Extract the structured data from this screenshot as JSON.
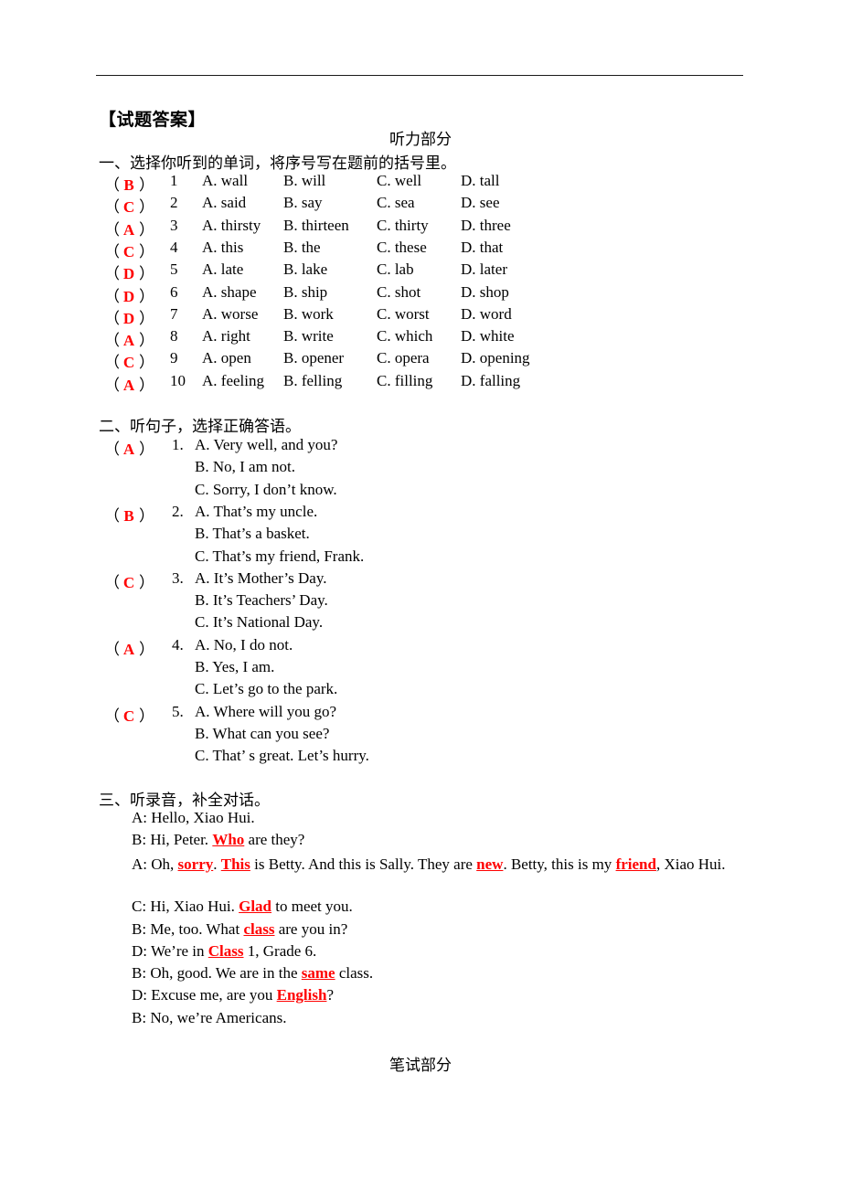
{
  "document": {
    "answer_key_heading": "【试题答案】",
    "listening_section_title": "听力部分",
    "written_section_title": "笔试部分"
  },
  "section_one": {
    "heading": "一、选择你听到的单词，将序号写在题前的括号里。",
    "paren_left": "（",
    "paren_right": "）",
    "rows": [
      {
        "answer": "B",
        "num": "1",
        "a": "A. wall",
        "b": "B. will",
        "c": "C. well",
        "d": "D. tall"
      },
      {
        "answer": "C",
        "num": "2",
        "a": "A. said",
        "b": "B. say",
        "c": "C. sea",
        "d": "D. see"
      },
      {
        "answer": "A",
        "num": "3",
        "a": "A. thirsty",
        "b": "B. thirteen",
        "c": "C. thirty",
        "d": "D. three"
      },
      {
        "answer": "C",
        "num": "4",
        "a": "A. this",
        "b": "B. the",
        "c": "C. these",
        "d": "D. that"
      },
      {
        "answer": "D",
        "num": "5",
        "a": "A. late",
        "b": "B. lake",
        "c": "C. lab",
        "d": "D. later"
      },
      {
        "answer": "D",
        "num": "6",
        "a": "A. shape",
        "b": "B. ship",
        "c": "C. shot",
        "d": "D. shop"
      },
      {
        "answer": "D",
        "num": "7",
        "a": "A. worse",
        "b": "B. work",
        "c": "C. worst",
        "d": "D. word"
      },
      {
        "answer": "A",
        "num": "8",
        "a": "A. right",
        "b": "B. write",
        "c": "C. which",
        "d": "D. white"
      },
      {
        "answer": "C",
        "num": "9",
        "a": "A. open",
        "b": "B. opener",
        "c": "C. opera",
        "d": "D. opening"
      },
      {
        "answer": "A",
        "num": "10",
        "a": "A. feeling",
        "b": "B. felling",
        "c": "C. filling",
        "d": "D. falling"
      }
    ]
  },
  "section_two": {
    "heading": "二、听句子，选择正确答语。",
    "paren_left": "（",
    "paren_right": "）",
    "items": [
      {
        "answer": "A",
        "num": "1.",
        "a": "A. Very well, and you?",
        "b": "B. No, I am not.",
        "c": "C. Sorry, I don’t know."
      },
      {
        "answer": "B",
        "num": "2.",
        "a": "A. That’s my uncle.",
        "b": "B. That’s a basket.",
        "c": "C. That’s my friend, Frank."
      },
      {
        "answer": "C",
        "num": "3.",
        "a": "A. It’s Mother’s Day.",
        "b": "B. It’s Teachers’ Day.",
        "c": "C. It’s National Day."
      },
      {
        "answer": "A",
        "num": "4.",
        "a": "A. No, I do not.",
        "b": "B. Yes, I am.",
        "c": "C. Let’s go to the park."
      },
      {
        "answer": "C",
        "num": "5.",
        "a": "A. Where will you go?",
        "b": "B. What can you see?",
        "c": "C. That’ s great. Let’s hurry."
      }
    ]
  },
  "section_three": {
    "heading": "三、听录音，补全对话。",
    "lines": [
      {
        "speaker": "A:",
        "text": "Hello, Xiao Hui."
      },
      {
        "speaker": "B:",
        "pre": "Hi, Peter. ",
        "blank": "Who",
        "post": " are they?"
      },
      {
        "speaker": "C:",
        "pre": "Hi, Xiao Hui. ",
        "blank": "Glad",
        "post": " to meet you."
      },
      {
        "speaker": "B:",
        "pre": "Me, too. What ",
        "blank": "class",
        "post": " are you in?"
      },
      {
        "speaker": "D:",
        "pre": "We’re in ",
        "blank": "Class",
        "post": " 1, Grade 6."
      },
      {
        "speaker": "B:",
        "pre": "Oh, good. We are in the ",
        "blank": "same",
        "post": " class."
      },
      {
        "speaker": "D:",
        "pre": "Excuse me, are you ",
        "blank": "English",
        "post": "?"
      },
      {
        "speaker": "B:",
        "text": "No, we’re Americans."
      }
    ],
    "wrapped_line": {
      "speaker": "A:",
      "p1": " Oh, ",
      "b1": "sorry",
      "p2": ". ",
      "b2": "This",
      "p3": " is Betty. And this is Sally. They are ",
      "b3": "new",
      "p4": ". Betty, this is my ",
      "b4": "friend",
      "p5": ", Xiao Hui."
    }
  },
  "colors": {
    "answer_red": "#ff0000",
    "text_black": "#000000",
    "rule": "#1a1a1a"
  }
}
